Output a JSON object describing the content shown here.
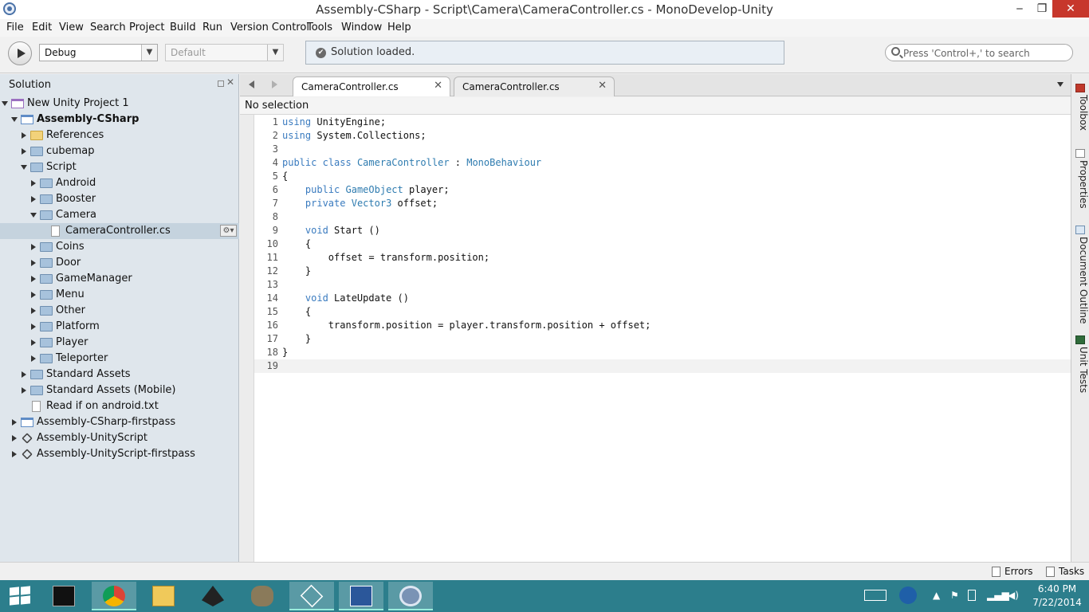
{
  "window": {
    "title": "Assembly-CSharp - Script\\Camera\\CameraController.cs - MonoDevelop-Unity",
    "minimize": "‒",
    "maximize": "❐",
    "close": "✕"
  },
  "menu": [
    "File",
    "Edit",
    "View",
    "Search",
    "Project",
    "Build",
    "Run",
    "Version Control",
    "Tools",
    "Window",
    "Help"
  ],
  "toolbar": {
    "configuration": "Debug",
    "platform": "Default",
    "status": "Solution loaded.",
    "search_placeholder": "Press 'Control+,' to search"
  },
  "solution": {
    "header": "Solution",
    "items": [
      {
        "label": "New Unity Project 1",
        "bold": false
      },
      {
        "label": "Assembly-CSharp",
        "bold": true
      },
      {
        "label": "References"
      },
      {
        "label": "cubemap"
      },
      {
        "label": "Script"
      },
      {
        "label": "Android"
      },
      {
        "label": "Booster"
      },
      {
        "label": "Camera"
      },
      {
        "label": "CameraController.cs",
        "selected": true
      },
      {
        "label": "Coins"
      },
      {
        "label": "Door"
      },
      {
        "label": "GameManager"
      },
      {
        "label": "Menu"
      },
      {
        "label": "Other"
      },
      {
        "label": "Platform"
      },
      {
        "label": "Player"
      },
      {
        "label": "Teleporter"
      },
      {
        "label": "Standard Assets"
      },
      {
        "label": "Standard Assets (Mobile)"
      },
      {
        "label": "Read if on android.txt"
      },
      {
        "label": "Assembly-CSharp-firstpass"
      },
      {
        "label": "Assembly-UnityScript"
      },
      {
        "label": "Assembly-UnityScript-firstpass"
      }
    ]
  },
  "editor": {
    "tabs": [
      "CameraController.cs",
      "CameraController.cs"
    ],
    "breadcrumb": "No selection",
    "lines": [
      {
        "n": "1",
        "text": "using UnityEngine;"
      },
      {
        "n": "2",
        "text": "using System.Collections;"
      },
      {
        "n": "3",
        "text": ""
      },
      {
        "n": "4",
        "text": "public class CameraController : MonoBehaviour"
      },
      {
        "n": "5",
        "text": "{"
      },
      {
        "n": "6",
        "text": "    public GameObject player;"
      },
      {
        "n": "7",
        "text": "    private Vector3 offset;"
      },
      {
        "n": "8",
        "text": ""
      },
      {
        "n": "9",
        "text": "    void Start ()"
      },
      {
        "n": "10",
        "text": "    {"
      },
      {
        "n": "11",
        "text": "        offset = transform.position;"
      },
      {
        "n": "12",
        "text": "    }"
      },
      {
        "n": "13",
        "text": ""
      },
      {
        "n": "14",
        "text": "    void LateUpdate ()"
      },
      {
        "n": "15",
        "text": "    {"
      },
      {
        "n": "16",
        "text": "        transform.position = player.transform.position + offset;"
      },
      {
        "n": "17",
        "text": "    }"
      },
      {
        "n": "18",
        "text": "}"
      },
      {
        "n": "19",
        "text": ""
      }
    ]
  },
  "side_rail": [
    "Toolbox",
    "Properties",
    "Document Outline",
    "Unit Tests"
  ],
  "statusbar": {
    "errors": "Errors",
    "tasks": "Tasks"
  },
  "taskbar": {
    "time": "6:40 PM",
    "date": "7/22/2014"
  },
  "colors": {
    "keyword": "#3a7bbf",
    "taskbar": "#2c7e8c",
    "close_button": "#c7372c",
    "selection": "#c5d3de"
  }
}
